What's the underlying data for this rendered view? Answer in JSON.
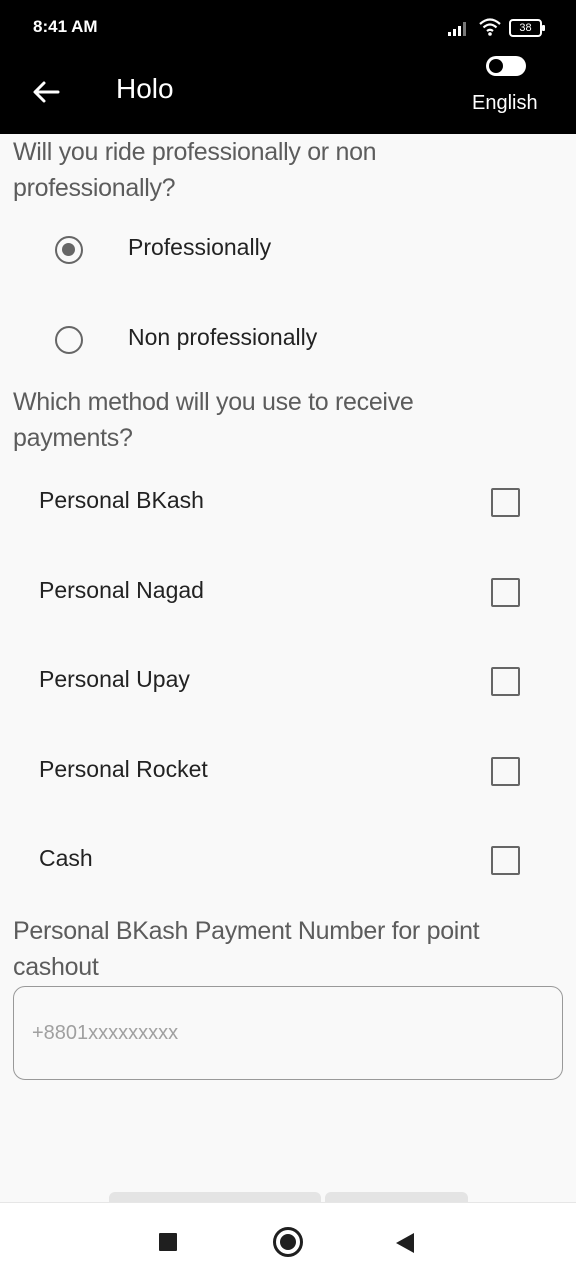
{
  "status_bar": {
    "time": "8:41 AM",
    "battery": "38",
    "icons": [
      "signal-icon",
      "wifi-icon",
      "battery-icon"
    ]
  },
  "app_bar": {
    "title": "Holo",
    "language_label": "English",
    "icons": [
      "back-arrow-icon",
      "language-toggle-icon"
    ]
  },
  "ride_question": {
    "label": "Will you ride professionally or non professionally?",
    "options": [
      {
        "label": "Professionally",
        "selected": true
      },
      {
        "label": "Non professionally",
        "selected": false
      }
    ]
  },
  "payment_question": {
    "label": "Which method will you use to receive payments?",
    "options": [
      {
        "label": "Personal BKash",
        "checked": false
      },
      {
        "label": "Personal Nagad",
        "checked": false
      },
      {
        "label": "Personal Upay",
        "checked": false
      },
      {
        "label": "Personal Rocket",
        "checked": false
      },
      {
        "label": "Cash",
        "checked": false
      }
    ]
  },
  "bkash_number": {
    "label": "Personal BKash Payment Number for point cashout",
    "value": "",
    "placeholder": "+8801xxxxxxxxx"
  },
  "nav_bar": {
    "icons": [
      "recent-apps-icon",
      "home-icon",
      "back-icon"
    ]
  },
  "colors": {
    "app_bar_bg": "#000000",
    "question_text": "#5c5c5c",
    "control": "#666666",
    "background": "#f9f9f9"
  }
}
